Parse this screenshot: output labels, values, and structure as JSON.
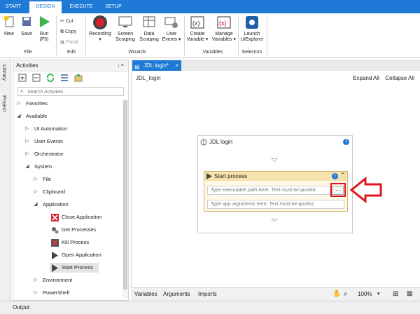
{
  "tabs": [
    "START",
    "DESIGN",
    "EXECUTE",
    "SETUP"
  ],
  "ribbon": {
    "new_label": "New",
    "save_label": "Save",
    "run_label": "Run",
    "run_sub": "(F5)",
    "cut_label": "Cut",
    "copy_label": "Copy",
    "paste_label": "Paste",
    "recording_label": "Recording",
    "screen_scraping_l1": "Screen",
    "screen_scraping_l2": "Scraping",
    "data_scraping_l1": "Data",
    "data_scraping_l2": "Scraping",
    "user_events_l1": "User",
    "user_events_l2": "Events",
    "create_variable_l1": "Create",
    "create_variable_l2": "Variable",
    "manage_variables_l1": "Manage",
    "manage_variables_l2": "Variables",
    "launch_l1": "Launch",
    "launch_l2": "UiExplorer",
    "groups": {
      "file": "File",
      "edit": "Edit",
      "wizards": "Wizards",
      "variables": "Variables",
      "selectors": "Selectors"
    }
  },
  "side_strip": {
    "library": "Library",
    "project": "Project"
  },
  "activities": {
    "title": "Activities",
    "pin": "↓ ×",
    "search_placeholder": "Search Activities",
    "tree": {
      "favorites": "Favorites",
      "available": "Available",
      "ui_automation": "UI Automation",
      "user_events": "User Events",
      "orchestrator": "Orchestrator",
      "system": "System",
      "file": "File",
      "clipboard": "Clipboard",
      "application": "Application",
      "close_application": "Close Application",
      "get_processes": "Get Processes",
      "kill_process": "Kill Process",
      "open_application": "Open Application",
      "start_process": "Start Process",
      "environment": "Environment",
      "powershell": "PowerShell"
    }
  },
  "document": {
    "tab_label": "JDL login*",
    "breadcrumb": "JDL_login",
    "expand_all": "Expand All",
    "collapse_all": "Collapse All",
    "sequence_title": "JDL login",
    "activity_title": "Start process",
    "path_placeholder": "Type executable path here. Text must be quoted",
    "args_placeholder": "Type app arguments here. Text must be quoted",
    "browse_label": "..."
  },
  "bottom": {
    "variables": "Variables",
    "arguments": "Arguments",
    "imports": "Imports",
    "zoom": "100%"
  },
  "output_label": "Output",
  "colors": {
    "accent": "#1e7ad6",
    "highlight": "#e0141f",
    "activity_bg": "#f6e2ad"
  }
}
